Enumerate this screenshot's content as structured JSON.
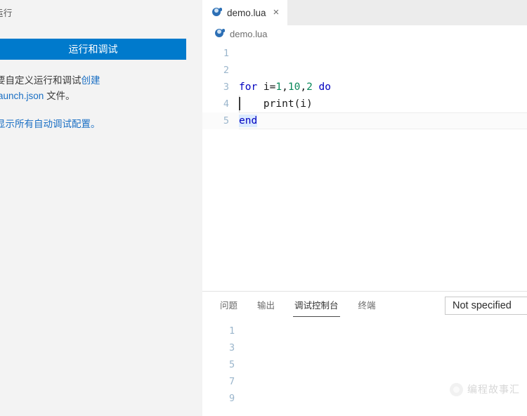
{
  "sidebar": {
    "title": "运行",
    "run_and_debug_button": "运行和调试",
    "help_line1": "要自定义运行和调试",
    "help_link_create": "创建",
    "help_link_launch": "launch.json",
    "help_line2_tail": " 文件。",
    "help_link_show_all": "显示所有自动调试配置。",
    "accent_color": "#007acc",
    "background_color": "#f3f3f3"
  },
  "editor": {
    "tab": {
      "label": "demo.lua",
      "icon": "lua-icon",
      "close_label": "×"
    },
    "breadcrumb": {
      "label": "demo.lua",
      "icon": "lua-icon"
    },
    "line_numbers": [
      "1",
      "2",
      "3",
      "4",
      "5"
    ],
    "lines": [
      {
        "n": "1",
        "tokens": []
      },
      {
        "n": "2",
        "tokens": []
      },
      {
        "n": "3",
        "tokens": [
          {
            "t": "for",
            "c": "kw"
          },
          {
            "t": " i=",
            "c": "plain"
          },
          {
            "t": "1",
            "c": "num"
          },
          {
            "t": ",",
            "c": "plain"
          },
          {
            "t": "10",
            "c": "num"
          },
          {
            "t": ",",
            "c": "plain"
          },
          {
            "t": "2",
            "c": "num"
          },
          {
            "t": " ",
            "c": "plain"
          },
          {
            "t": "do",
            "c": "kw"
          }
        ]
      },
      {
        "n": "4",
        "tokens": [
          {
            "t": "    print(i)",
            "c": "plain"
          }
        ]
      },
      {
        "n": "5",
        "tokens": [
          {
            "t": "end",
            "c": "kw",
            "sel": true
          }
        ]
      }
    ],
    "code_plain_text_line3": "for i=1,10,2 do",
    "code_plain_text_line4": "    print(i)",
    "code_plain_text_line5": "end",
    "keyword_color": "#0000c0",
    "number_color": "#09885a",
    "selection_color": "#dbeafe"
  },
  "panel": {
    "tabs": [
      {
        "label": "问题",
        "active": false
      },
      {
        "label": "输出",
        "active": false
      },
      {
        "label": "调试控制台",
        "active": true
      },
      {
        "label": "终端",
        "active": false
      }
    ],
    "filter_select_value": "Not specified",
    "console_output": [
      "1",
      "3",
      "5",
      "7",
      "9"
    ]
  },
  "watermark": {
    "text": "编程故事汇"
  }
}
